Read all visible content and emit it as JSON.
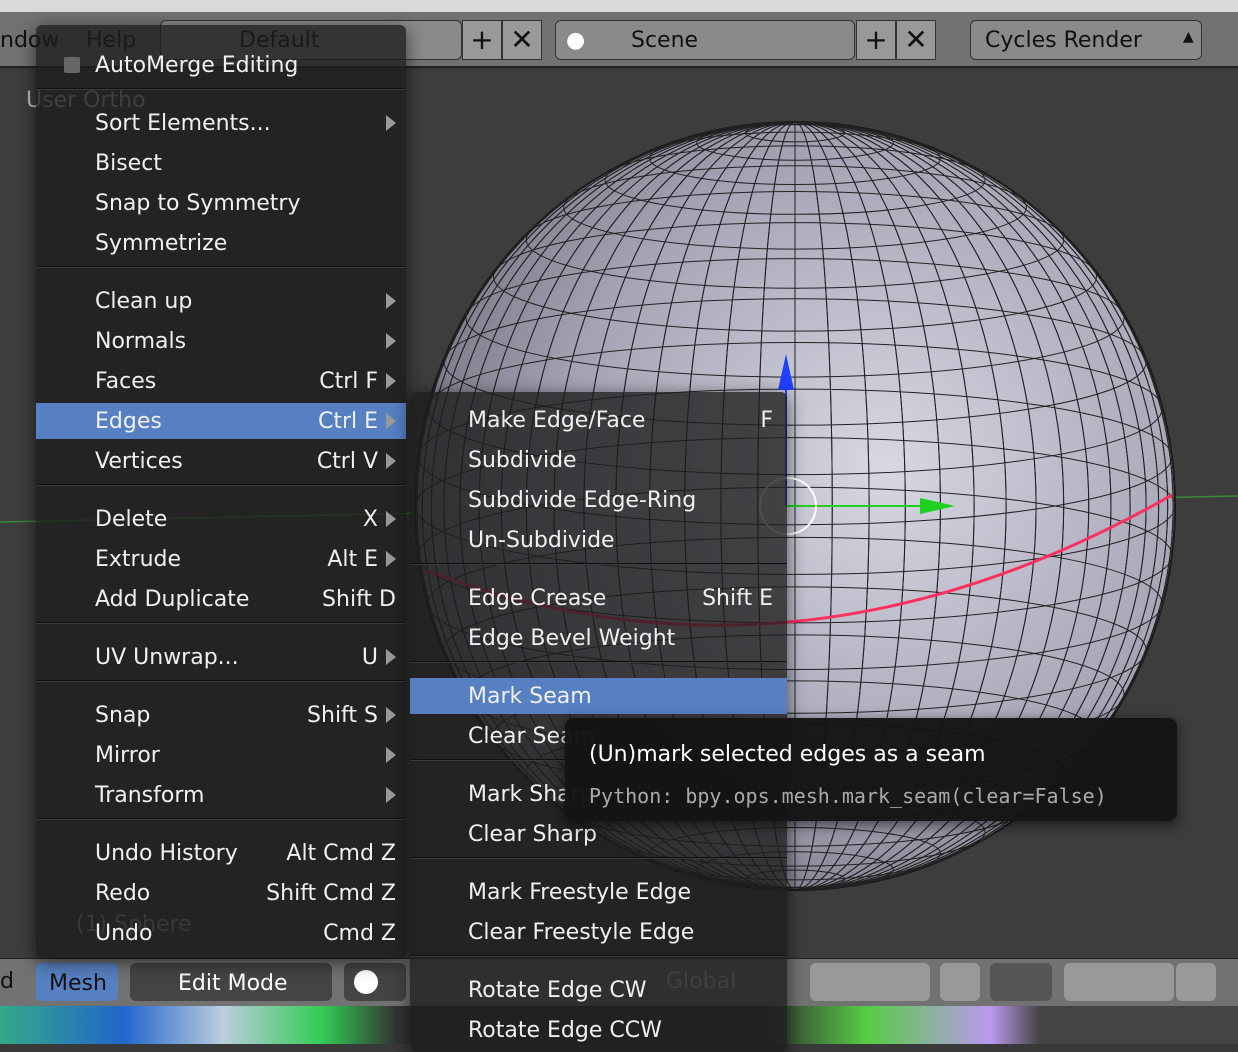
{
  "topbar": {
    "menu_window": "ndow",
    "menu_help": "Help",
    "layout": "Default",
    "scene": "Scene",
    "render_engine": "Cycles Render"
  },
  "viewport": {
    "view_label": "User Ortho",
    "object_label": "(1) Sphere"
  },
  "main_menu": [
    {
      "type": "check",
      "label": "AutoMerge Editing"
    },
    {
      "type": "sep"
    },
    {
      "label": "Sort Elements...",
      "submenu": true
    },
    {
      "label": "Bisect"
    },
    {
      "label": "Snap to Symmetry"
    },
    {
      "label": "Symmetrize"
    },
    {
      "type": "sep"
    },
    {
      "label": "Clean up",
      "submenu": true
    },
    {
      "label": "Normals",
      "submenu": true
    },
    {
      "label": "Faces",
      "shortcut": "Ctrl F",
      "submenu": true
    },
    {
      "label": "Edges",
      "shortcut": "Ctrl E",
      "submenu": true,
      "highlighted": true
    },
    {
      "label": "Vertices",
      "shortcut": "Ctrl V",
      "submenu": true
    },
    {
      "type": "sep"
    },
    {
      "label": "Delete",
      "shortcut": "X",
      "submenu": true
    },
    {
      "label": "Extrude",
      "shortcut": "Alt E",
      "submenu": true
    },
    {
      "label": "Add Duplicate",
      "shortcut": "Shift D"
    },
    {
      "type": "sep"
    },
    {
      "label": "UV Unwrap...",
      "shortcut": "U",
      "submenu": true
    },
    {
      "type": "sep"
    },
    {
      "label": "Snap",
      "shortcut": "Shift S",
      "submenu": true
    },
    {
      "label": "Mirror",
      "submenu": true
    },
    {
      "label": "Transform",
      "submenu": true
    },
    {
      "type": "sep"
    },
    {
      "label": "Undo History",
      "shortcut": "Alt Cmd Z"
    },
    {
      "label": "Redo",
      "shortcut": "Shift Cmd Z"
    },
    {
      "label": "Undo",
      "shortcut": "Cmd Z"
    }
  ],
  "edges_menu": [
    {
      "label": "Make Edge/Face",
      "shortcut": "F"
    },
    {
      "label": "Subdivide"
    },
    {
      "label": "Subdivide Edge-Ring"
    },
    {
      "label": "Un-Subdivide"
    },
    {
      "type": "sep"
    },
    {
      "label": "Edge Crease",
      "shortcut": "Shift E"
    },
    {
      "label": "Edge Bevel Weight"
    },
    {
      "type": "sep"
    },
    {
      "label": "Mark Seam",
      "highlighted": true
    },
    {
      "label": "Clear Seam"
    },
    {
      "type": "sep"
    },
    {
      "label": "Mark Sharp"
    },
    {
      "label": "Clear Sharp"
    },
    {
      "type": "sep"
    },
    {
      "label": "Mark Freestyle Edge"
    },
    {
      "label": "Clear Freestyle Edge"
    },
    {
      "type": "sep"
    },
    {
      "label": "Rotate Edge CW"
    },
    {
      "label": "Rotate Edge CCW"
    }
  ],
  "tooltip": {
    "description": "(Un)mark selected edges as a seam",
    "python": "Python: bpy.ops.mesh.mark_seam(clear=False)"
  },
  "bottombar": {
    "left_cut": "d",
    "mesh_menu": "Mesh",
    "mode": "Edit Mode",
    "orientation": "Global"
  },
  "colors": {
    "highlight": "#5680c2",
    "seam": "#ff3060",
    "header": "#727272"
  }
}
